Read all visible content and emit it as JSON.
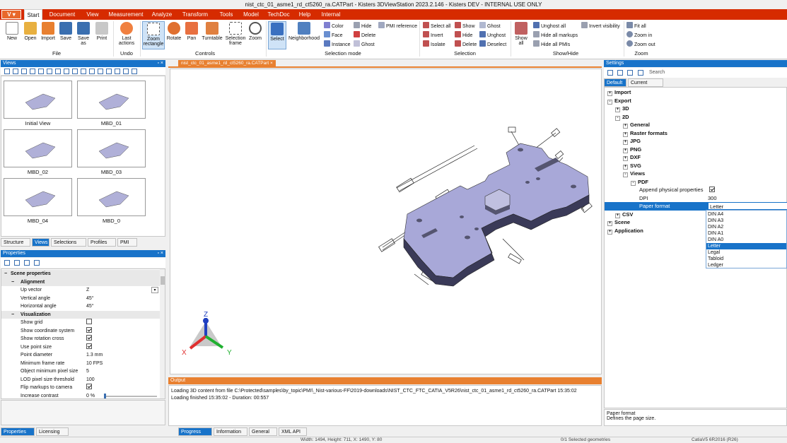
{
  "window": {
    "title": "nist_ctc_01_asme1_rd_ct5260_ra.CATPart - Kisters 3DViewStation 2023.2.146 - Kisters DEV - INTERNAL USE ONLY"
  },
  "app_button": "V",
  "menu": [
    "Start",
    "Document",
    "View",
    "Measurement",
    "Analyze",
    "Transform",
    "Tools",
    "Model",
    "TechDoc",
    "Help",
    "Internal"
  ],
  "ribbon": {
    "file": {
      "label": "File",
      "new": "New",
      "open": "Open",
      "import": "Import",
      "save": "Save",
      "save_as": "Save as",
      "print": "Print"
    },
    "undo": {
      "label": "Undo",
      "last_actions": "Last actions"
    },
    "controls": {
      "label": "Controls",
      "zoom_rectangle": "Zoom rectangle",
      "rotate": "Rotate",
      "pan": "Pan",
      "turntable": "Turntable",
      "selection_frame": "Selection frame",
      "zoom": "Zoom"
    },
    "selection_mode": {
      "label": "Selection mode",
      "select": "Select",
      "neighborhood": "Neighborhood",
      "color": "Color",
      "face": "Face",
      "instance": "Instance",
      "hide": "Hide",
      "delete": "Delete",
      "ghost": "Ghost",
      "pmi_reference": "PMI reference"
    },
    "selection": {
      "label": "Selection",
      "select_all": "Select all",
      "invert": "Invert",
      "isolate": "Isolate",
      "show": "Show",
      "hide": "Hide",
      "delete": "Delete",
      "ghost": "Ghost",
      "unghost": "Unghost",
      "deselect": "Deselect"
    },
    "show_hide": {
      "label": "Show/Hide",
      "show_all": "Show all",
      "unghost_all": "Unghost all",
      "hide_all_markups": "Hide all markups",
      "hide_all_pmis": "Hide all PMIs",
      "invert_visibility": "Invert visibility"
    },
    "zoom": {
      "label": "Zoom",
      "fit_all": "Fit all",
      "zoom_in": "Zoom in",
      "zoom_out": "Zoom out"
    }
  },
  "views_panel": {
    "title": "Views",
    "thumbnails": [
      "Initial View",
      "MBD_01",
      "MBD_02",
      "MBD_03",
      "MBD_04",
      "MBD_0"
    ],
    "tabs": [
      "Structure",
      "Views",
      "Selections",
      "Profiles",
      "PMI"
    ]
  },
  "properties_panel": {
    "title": "Properties",
    "rows": [
      {
        "type": "group",
        "key": "Scene properties"
      },
      {
        "type": "sub",
        "key": "Alignment"
      },
      {
        "type": "prop",
        "key": "Up vector",
        "value": "Z",
        "dropdown": true
      },
      {
        "type": "prop",
        "key": "Vertical angle",
        "value": "45°"
      },
      {
        "type": "prop",
        "key": "Horizontal angle",
        "value": "45°"
      },
      {
        "type": "sub",
        "key": "Visualization"
      },
      {
        "type": "check",
        "key": "Show grid",
        "checked": false
      },
      {
        "type": "check",
        "key": "Show coordinate system",
        "checked": true
      },
      {
        "type": "check",
        "key": "Show rotation cross",
        "checked": true
      },
      {
        "type": "check",
        "key": "Use point size",
        "checked": true
      },
      {
        "type": "prop",
        "key": "Point diameter",
        "value": "1.3 mm"
      },
      {
        "type": "prop",
        "key": "Minimum frame rate",
        "value": "10 FPS"
      },
      {
        "type": "prop",
        "key": "Object minimum pixel size",
        "value": "5"
      },
      {
        "type": "prop",
        "key": "LOD pixel size threshold",
        "value": "100"
      },
      {
        "type": "check",
        "key": "Flip markups to camera",
        "checked": true
      },
      {
        "type": "slider",
        "key": "Increase contrast",
        "value": "0 %"
      }
    ],
    "tabs": [
      "Properties",
      "Licensing"
    ]
  },
  "document_tab": "nist_ctc_01_asme1_rd_ct5260_ra.CATPart",
  "axes": {
    "x": "X",
    "y": "Y",
    "z": "Z"
  },
  "output_panel": {
    "title": "Output",
    "lines": [
      "Loading 3D content from file C:\\Protected\\samples\\by_topic\\PMI\\_Nist-various-FF\\2019-downloads\\NIST_CTC_FTC_CATIA_V5R26\\nist_ctc_01_asme1_rd_ct5260_ra.CATPart 15:35:02",
      "Loading finished 15:35:02 - Duration: 00:557"
    ],
    "tabs": [
      "Progress",
      "Information",
      "General",
      "XML API"
    ]
  },
  "settings_panel": {
    "title": "Settings",
    "search_label": "Search",
    "tabs": [
      "Default",
      "Current scene"
    ],
    "tree": [
      {
        "label": "Import",
        "level": 0,
        "bold": true,
        "exp": "+"
      },
      {
        "label": "Export",
        "level": 0,
        "bold": true,
        "exp": "-"
      },
      {
        "label": "3D",
        "level": 1,
        "bold": true,
        "exp": "+"
      },
      {
        "label": "2D",
        "level": 1,
        "bold": true,
        "exp": "-"
      },
      {
        "label": "General",
        "level": 2,
        "bold": true,
        "exp": "+"
      },
      {
        "label": "Raster formats",
        "level": 2,
        "bold": true,
        "exp": "+"
      },
      {
        "label": "JPG",
        "level": 2,
        "bold": true,
        "exp": "+"
      },
      {
        "label": "PNG",
        "level": 2,
        "bold": true,
        "exp": "+"
      },
      {
        "label": "DXF",
        "level": 2,
        "bold": true,
        "exp": "+"
      },
      {
        "label": "SVG",
        "level": 2,
        "bold": true,
        "exp": "+"
      },
      {
        "label": "Views",
        "level": 2,
        "bold": true,
        "exp": "-"
      },
      {
        "label": "PDF",
        "level": 3,
        "bold": true,
        "exp": "-"
      }
    ],
    "pdf_props": [
      {
        "key": "Append physical properties",
        "value": "",
        "check": true
      },
      {
        "key": "DPI",
        "value": "300"
      },
      {
        "key": "Paper format",
        "value": "Letter",
        "selected": true
      }
    ],
    "tree_after": [
      {
        "label": "CSV",
        "level": 1,
        "bold": true,
        "exp": "+"
      },
      {
        "label": "Scene",
        "level": 0,
        "bold": true,
        "exp": "+"
      },
      {
        "label": "Application",
        "level": 0,
        "bold": true,
        "exp": "+"
      }
    ],
    "paper_options": [
      "DIN A4",
      "DIN A3",
      "DIN A2",
      "DIN A1",
      "DIN A0",
      "Letter",
      "Legal",
      "Tabloid",
      "Ledger"
    ],
    "paper_selected": "Letter",
    "help_title": "Paper format",
    "help_text": "Defines the page size."
  },
  "status_bar": {
    "dims": "Width: 1494, Height: 711, X: 1490, Y: 80",
    "selected": "0/1 Selected geometries",
    "version": "CatiaV5 6R2016 (R26)"
  },
  "colors": {
    "accent": "#d62b00",
    "panel_head": "#1873c9",
    "part": "#a8a8d8",
    "selection": "#1873c9"
  }
}
